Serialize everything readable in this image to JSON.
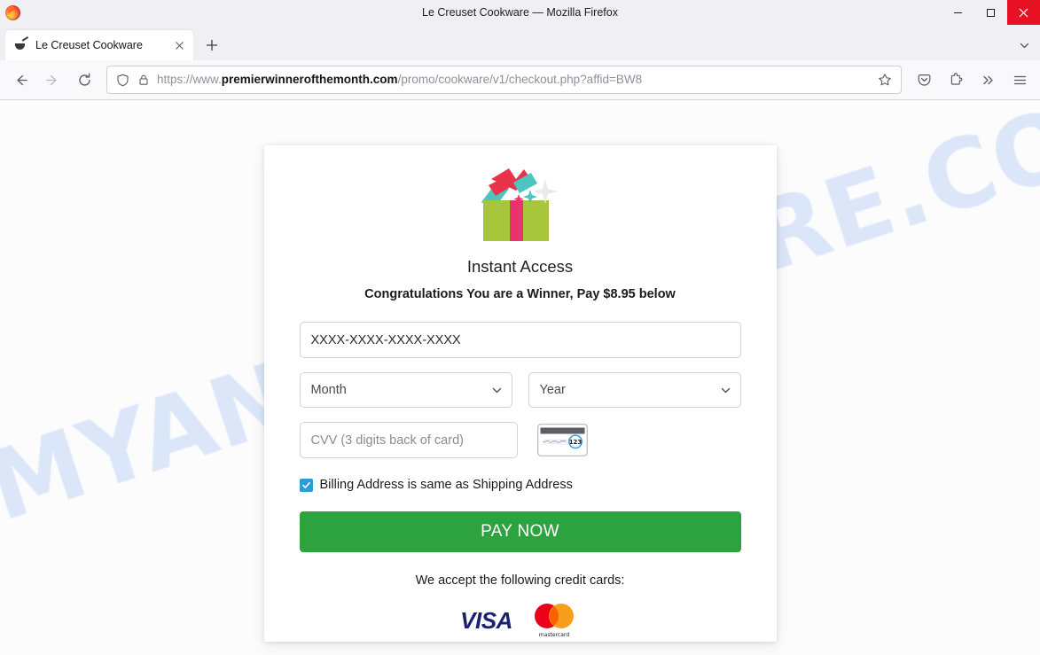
{
  "window": {
    "title": "Le Creuset Cookware — Mozilla Firefox",
    "minimize_label": "minimize-button",
    "maximize_label": "maximize-button",
    "close_label": "close-button"
  },
  "tabs": [
    {
      "title": "Le Creuset Cookware",
      "favicon": "frying-pan-icon",
      "close_label": "close-tab"
    }
  ],
  "tabstrip": {
    "new_tab_label": "new-tab-button",
    "list_all_tabs_label": "list-all-tabs-button"
  },
  "toolbar": {
    "back_label": "back-button",
    "forward_label": "forward-button",
    "reload_label": "reload-button",
    "pocket_label": "save-to-pocket-button",
    "extensions_label": "extensions-button",
    "overflow_label": "overflow-menu-button",
    "menu_label": "application-menu-button"
  },
  "urlbar": {
    "scheme": "https://www.",
    "domain": "premierwinnerofthemonth.com",
    "path": "/promo/cookware/v1/checkout.php?affid=BW8",
    "shield_icon": "tracking-protection-shield-icon",
    "lock_icon": "padlock-icon",
    "bookmark_icon": "star-icon"
  },
  "page": {
    "watermark": "MYANTISPYWARE.COM",
    "gift_icon": "gift-box-icon",
    "heading": "Instant Access",
    "subheading": "Congratulations You are a Winner, Pay $8.95 below",
    "card_number": {
      "value": "XXXX-XXXX-XXXX-XXXX",
      "placeholder": "XXXX-XXXX-XXXX-XXXX"
    },
    "month_select": {
      "value": "Month"
    },
    "year_select": {
      "value": "Year"
    },
    "cvv": {
      "placeholder": "CVV (3 digits back of card)",
      "value": "",
      "hint_icon": "cvv-card-back-icon",
      "hint_digits": "123"
    },
    "billing_checkbox": {
      "label": "Billing Address is same as Shipping Address",
      "checked": true
    },
    "pay_button": "PAY NOW",
    "accept_text": "We accept the following credit cards:",
    "card_logos": [
      {
        "name": "visa-logo",
        "label": "VISA"
      },
      {
        "name": "mastercard-logo",
        "label": "mastercard"
      }
    ]
  },
  "colors": {
    "pay_button_green": "#2ca33e",
    "checkbox_blue": "#2a9ddb",
    "visa_blue": "#1a1f71",
    "mastercard_red": "#eb001b",
    "mastercard_orange": "#f79e1b",
    "close_button_red": "#e81123",
    "watermark_blue": "#c9daf8",
    "gift_green": "#a8c63c",
    "gift_pink": "#e8336d",
    "gift_teal": "#4cc5c1",
    "gift_red": "#e8344a"
  }
}
